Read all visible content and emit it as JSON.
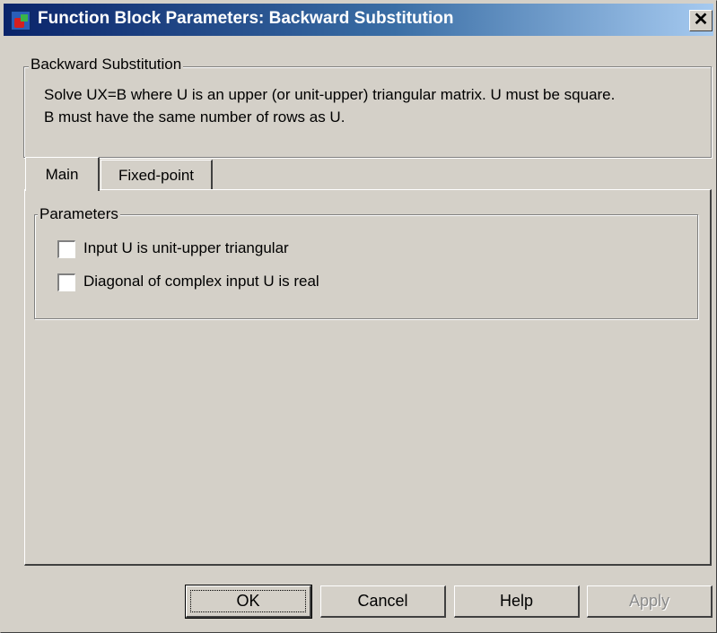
{
  "window": {
    "title": "Function Block Parameters: Backward Substitution",
    "close_symbol": "✕",
    "icon": "simulink-block-icon"
  },
  "block": {
    "group_label": "Backward Substitution",
    "description_line1": "Solve UX=B where U is an upper (or unit-upper) triangular matrix.  U must be square.",
    "description_line2": "B must have the same number of rows as U."
  },
  "tabs": [
    {
      "label": "Main",
      "active": true
    },
    {
      "label": "Fixed-point",
      "active": false
    }
  ],
  "parameters": {
    "group_label": "Parameters",
    "checkboxes": [
      {
        "label": "Input U is unit-upper triangular",
        "checked": false
      },
      {
        "label": "Diagonal of complex input U is real",
        "checked": false
      }
    ]
  },
  "buttons": {
    "ok": "OK",
    "cancel": "Cancel",
    "help": "Help",
    "apply": "Apply"
  },
  "colors": {
    "titlebar_start": "#0a246a",
    "titlebar_end": "#a6caf0",
    "face": "#d4d0c8"
  }
}
